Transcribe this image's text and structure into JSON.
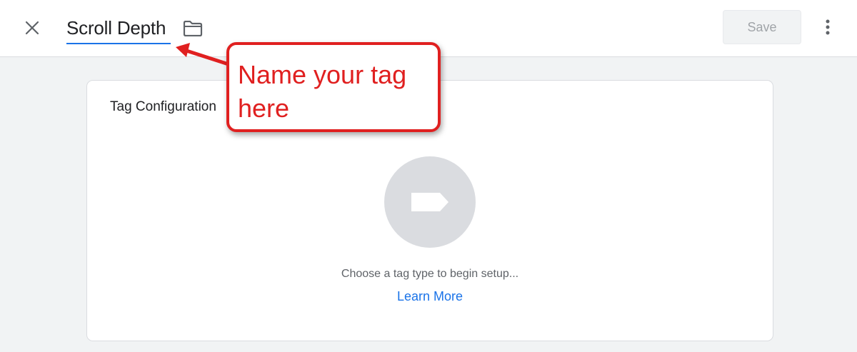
{
  "header": {
    "tag_name": "Scroll Depth",
    "save_label": "Save",
    "icons": {
      "close": "close-icon",
      "folder": "folder-icon",
      "more": "more-vert-icon"
    }
  },
  "tag_config": {
    "title": "Tag Configuration",
    "hint": "Choose a tag type to begin setup...",
    "learn_more": "Learn More",
    "icon": "tag-icon"
  },
  "annotation": {
    "text": "Name your tag here"
  },
  "colors": {
    "accent": "#1a73e8",
    "annotation": "#e02020",
    "background": "#f1f3f4"
  }
}
